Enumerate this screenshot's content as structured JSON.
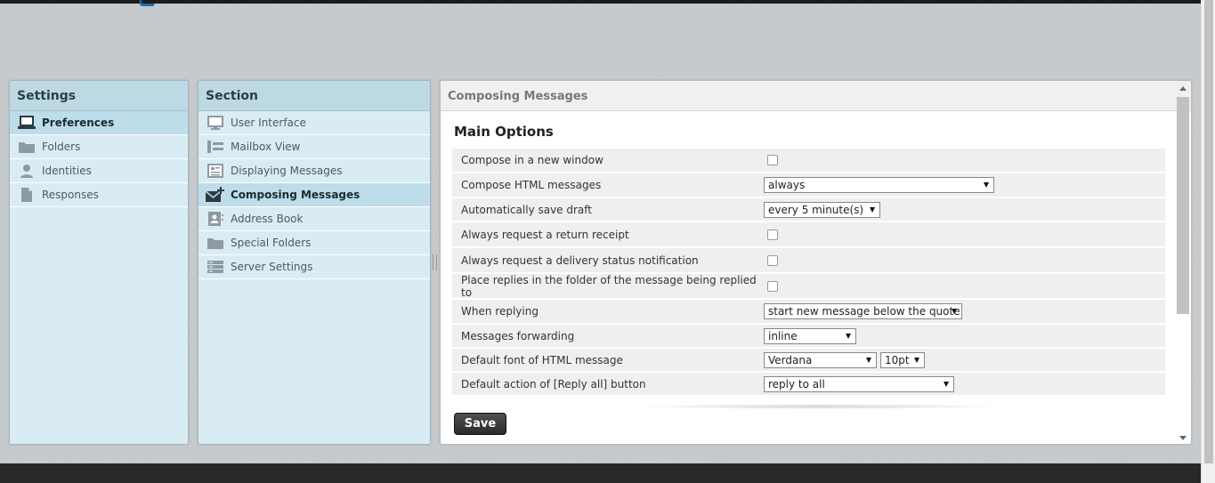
{
  "settings": {
    "title": "Settings",
    "items": [
      {
        "label": "Preferences",
        "icon": "laptop-icon",
        "selected": true
      },
      {
        "label": "Folders",
        "icon": "folder-icon",
        "selected": false
      },
      {
        "label": "Identities",
        "icon": "person-icon",
        "selected": false
      },
      {
        "label": "Responses",
        "icon": "document-icon",
        "selected": false
      }
    ]
  },
  "section": {
    "title": "Section",
    "items": [
      {
        "label": "User Interface",
        "icon": "monitor-icon",
        "selected": false
      },
      {
        "label": "Mailbox View",
        "icon": "list-layout-icon",
        "selected": false
      },
      {
        "label": "Displaying Messages",
        "icon": "message-view-icon",
        "selected": false
      },
      {
        "label": "Composing Messages",
        "icon": "compose-envelope-icon",
        "selected": true
      },
      {
        "label": "Address Book",
        "icon": "address-book-icon",
        "selected": false
      },
      {
        "label": "Special Folders",
        "icon": "folder-icon",
        "selected": false
      },
      {
        "label": "Server Settings",
        "icon": "server-icon",
        "selected": false
      }
    ]
  },
  "content": {
    "title": "Composing Messages",
    "fieldset_title": "Main Options",
    "options": [
      {
        "label": "Compose in a new window",
        "type": "checkbox",
        "checked": false
      },
      {
        "label": "Compose HTML messages",
        "type": "select",
        "value": "always"
      },
      {
        "label": "Automatically save draft",
        "type": "select",
        "value": "every 5 minute(s)"
      },
      {
        "label": "Always request a return receipt",
        "type": "checkbox",
        "checked": false
      },
      {
        "label": "Always request a delivery status notification",
        "type": "checkbox",
        "checked": false
      },
      {
        "label": "Place replies in the folder of the message being replied to",
        "type": "checkbox",
        "checked": false
      },
      {
        "label": "When replying",
        "type": "select",
        "value": "start new message below the quote"
      },
      {
        "label": "Messages forwarding",
        "type": "select",
        "value": "inline"
      },
      {
        "label": "Default font of HTML message",
        "type": "select",
        "value": "Verdana",
        "value2": "10pt"
      },
      {
        "label": "Default action of [Reply all] button",
        "type": "select",
        "value": "reply to all"
      }
    ],
    "save_label": "Save"
  },
  "colors": {
    "panel_bg": "#d9ecf4",
    "header_bg": "#bcd9e4",
    "selected_bg": "#bcdde9",
    "topbar": "#1c1c1c",
    "accent": "#1a6fb3"
  }
}
